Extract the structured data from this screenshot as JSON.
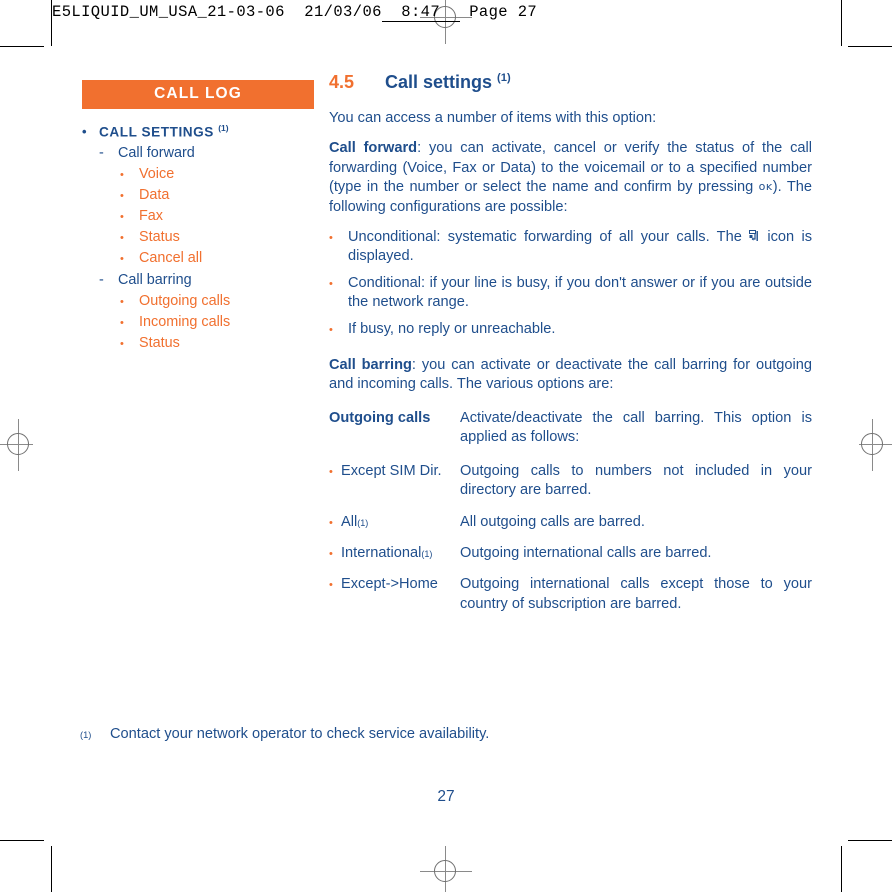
{
  "colors": {
    "orange": "#F1702F",
    "navy": "#1F4E8C",
    "white": "#FFFFFF",
    "black": "#000000"
  },
  "print_header": {
    "filename": "E5LIQUID_UM_USA_21-03-06",
    "date": "21/03/06",
    "time": "8:47",
    "page_label": "Page 27"
  },
  "sidebar": {
    "banner": "CALL LOG",
    "items": [
      {
        "level": 1,
        "marker": "•",
        "label": "CALL SETTINGS",
        "footnote": "(1)"
      },
      {
        "level": 2,
        "marker": "-",
        "label": "Call forward"
      },
      {
        "level": 3,
        "marker": "•",
        "label": "Voice"
      },
      {
        "level": 3,
        "marker": "•",
        "label": "Data"
      },
      {
        "level": 3,
        "marker": "•",
        "label": "Fax"
      },
      {
        "level": 3,
        "marker": "•",
        "label": "Status"
      },
      {
        "level": 3,
        "marker": "•",
        "label": "Cancel all"
      },
      {
        "level": 2,
        "marker": "-",
        "label": "Call barring"
      },
      {
        "level": 3,
        "marker": "•",
        "label": "Outgoing calls"
      },
      {
        "level": 3,
        "marker": "•",
        "label": "Incoming calls"
      },
      {
        "level": 3,
        "marker": "•",
        "label": "Status"
      }
    ]
  },
  "main": {
    "section_number": "4.5",
    "section_title": "Call settings",
    "section_title_footnote": "(1)",
    "intro": "You can access a number of items with this option:",
    "call_forward": {
      "term": "Call forward",
      "text_part1": ": you can activate, cancel or verify the status of the call forwarding (Voice, Fax or Data) to the voicemail or to a specified number (type in the number or select the name and confirm by pressing ",
      "ok_key": "oĸ",
      "text_part2": "). The following configurations are possible:",
      "bullets": [
        {
          "marker": "•",
          "text_before": "Unconditional: systematic forwarding of all your calls. The ",
          "icon": "call-forward-icon",
          "text_after": " icon is displayed."
        },
        {
          "marker": "•",
          "text_before": "Conditional: if your line is busy, if you don't answer or if you are outside the network range.",
          "icon": null,
          "text_after": ""
        },
        {
          "marker": "•",
          "text_before": "If busy, no reply or unreachable.",
          "icon": null,
          "text_after": ""
        }
      ]
    },
    "call_barring": {
      "term": "Call barring",
      "text": ": you can activate or deactivate the call barring for outgoing and incoming calls. The various options are:",
      "rows": [
        {
          "bold_term": true,
          "marker": "",
          "term": "Outgoing calls",
          "footnote": "",
          "desc": "Activate/deactivate the call barring. This option is applied as follows:"
        },
        {
          "bold_term": false,
          "marker": "•",
          "term": "Except SIM Dir.",
          "footnote": "",
          "desc": "Outgoing calls to numbers not included in your directory are barred."
        },
        {
          "bold_term": false,
          "marker": "•",
          "term": "All",
          "footnote": "(1)",
          "desc": "All outgoing calls are barred."
        },
        {
          "bold_term": false,
          "marker": "•",
          "term": "International",
          "footnote": "(1)",
          "desc": "Outgoing international calls are barred."
        },
        {
          "bold_term": false,
          "marker": "•",
          "term": "Except->Home",
          "footnote": "",
          "desc": "Outgoing international calls except those to your country of subscription are barred."
        }
      ]
    }
  },
  "footnote": {
    "marker": "(1)",
    "text": "Contact your network operator to check service availability."
  },
  "page_number": "27"
}
